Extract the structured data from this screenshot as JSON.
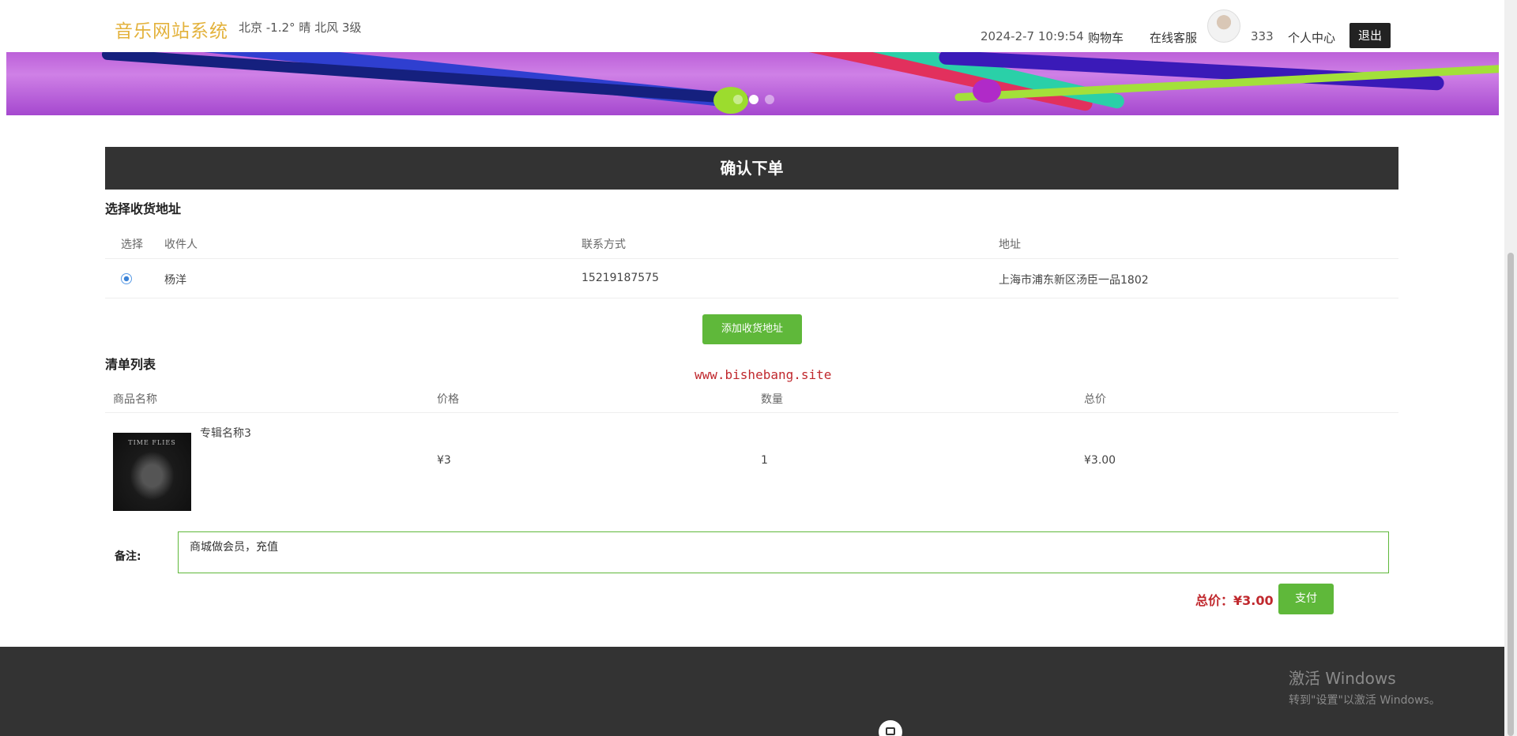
{
  "header": {
    "logo": "音乐网站系统",
    "weather": "北京  -1.2°  晴  北风  3级",
    "datetime": "2024-2-7 10:9:54",
    "cart": "购物车",
    "service": "在线客服",
    "username": "333",
    "profile": "个人中心",
    "logout": "退出"
  },
  "banner": {
    "active_dot": 2,
    "dot_count": 3
  },
  "order": {
    "title": "确认下单",
    "address_section": "选择收货地址",
    "address_headers": [
      "选择",
      "收件人",
      "联系方式",
      "地址"
    ],
    "address_row": {
      "name": "杨洋",
      "phone": "15219187575",
      "address": "上海市浦东新区汤臣一品1802"
    },
    "add_address_button": "添加收货地址",
    "list_section": "清单列表",
    "watermark": "www.bishebang.site",
    "list_headers": [
      "商品名称",
      "价格",
      "数量",
      "总价"
    ],
    "item": {
      "name": "专辑名称3",
      "price": "¥3",
      "quantity": "1",
      "total": "¥3.00",
      "cover_text": "TIME FLIES"
    },
    "note_label": "备注:",
    "note_value": "商城做会员，充值",
    "total_label": "总价：¥3.00",
    "pay_button": "支付"
  },
  "footer": {
    "activate_title": "激活 Windows",
    "activate_sub": "转到\"设置\"以激活 Windows。"
  },
  "colors": {
    "accent_green": "#5fb83a",
    "title_bar": "#333333",
    "price_red": "#c0282d",
    "logo_gold": "#e3b23c"
  }
}
